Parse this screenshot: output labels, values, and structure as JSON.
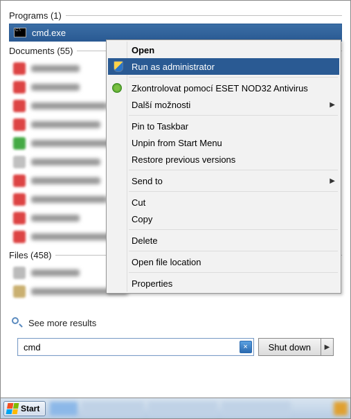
{
  "sections": {
    "programs_header": "Programs (1)",
    "documents_header": "Documents (55)",
    "files_header": "Files (458)"
  },
  "program": {
    "name": "cmd.exe"
  },
  "see_more": "See more results",
  "search": {
    "value": "cmd",
    "clear": "×"
  },
  "shutdown": {
    "label": "Shut down"
  },
  "start": {
    "label": "Start"
  },
  "context_menu": {
    "open": "Open",
    "run_admin": "Run as administrator",
    "eset": "Zkontrolovat pomocí ESET NOD32 Antivirus",
    "more": "Další možnosti",
    "pin": "Pin to Taskbar",
    "unpin": "Unpin from Start Menu",
    "restore": "Restore previous versions",
    "sendto": "Send to",
    "cut": "Cut",
    "copy": "Copy",
    "delete": "Delete",
    "openloc": "Open file location",
    "props": "Properties"
  }
}
